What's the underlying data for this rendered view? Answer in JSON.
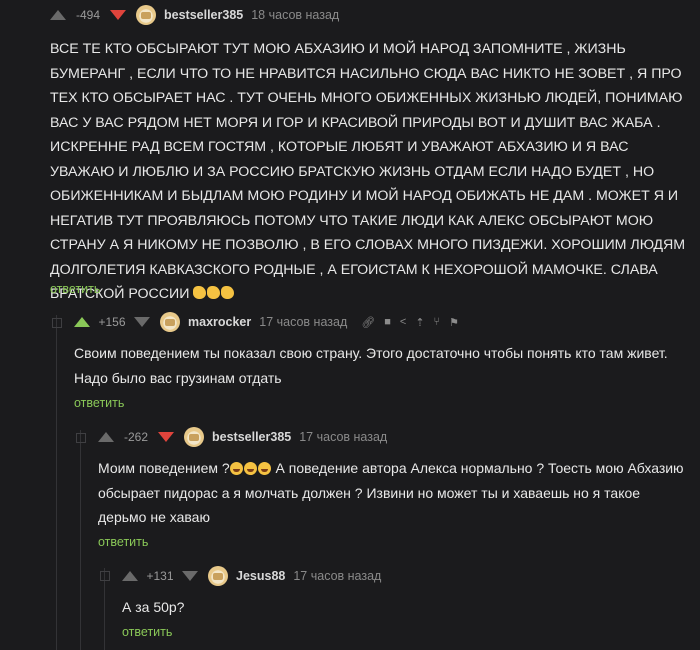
{
  "reply_label": "ответить",
  "comments": [
    {
      "score": "-494",
      "username": "bestseller385",
      "time": "18 часов назад",
      "text": "ВСЕ ТЕ КТО ОБСЫРАЮТ ТУТ МОЮ АБХАЗИЮ И МОЙ НАРОД ЗАПОМНИТЕ , ЖИЗНЬ БУМЕРАНГ , ЕСЛИ ЧТО ТО НЕ НРАВИТСЯ НАСИЛЬНО СЮДА ВАС НИКТО НЕ ЗОВЕТ , Я ПРО ТЕХ КТО ОБСЫРАЕТ НАС . ТУТ ОЧЕНЬ МНОГО ОБИЖЕННЫХ ЖИЗНЬЮ ЛЮДЕЙ, ПОНИМАЮ ВАС У ВАС РЯДОМ НЕТ МОРЯ И ГОР И КРАСИВОЙ ПРИРОДЫ ВОТ И ДУШИТ ВАС ЖАБА . ИСКРЕННЕ РАД ВСЕМ ГОСТЯМ , КОТОРЫЕ ЛЮБЯТ И УВАЖАЮТ АБХАЗИЮ И Я ВАС УВАЖАЮ И ЛЮБЛЮ И ЗА РОССИЮ БРАТСКУЮ ЖИЗНЬ ОТДАМ ЕСЛИ НАДО БУДЕТ , НО ОБИЖЕННИКАМ И БЫДЛАМ МОЮ РОДИНУ И МОЙ НАРОД ОБИЖАТЬ НЕ ДАМ . МОЖЕТ Я И НЕГАТИВ ТУТ ПРОЯВЛЯЮСЬ ПОТОМУ ЧТО ТАКИЕ ЛЮДИ КАК АЛЕКС ОБСЫРАЮТ МОЮ СТРАНУ А Я НИКОМУ НЕ ПОЗВОЛЮ , В ЕГО СЛОВАХ МНОГО ПИЗДЕЖИ. ХОРОШИМ ЛЮДЯМ ДОЛГОЛЕТИЯ КАВКАЗСКОГО РОДНЫЕ , А ЕГОИСТАМ  К НЕХОРОШОЙ МАМОЧКЕ. СЛАВА БРАТСКОЙ РОССИИ"
    },
    {
      "score": "+156",
      "username": "maxrocker",
      "time": "17 часов назад",
      "text": "Своим поведением ты показал свою страну. Этого достаточно чтобы понять кто там живет. Надо было вас грузинам отдать"
    },
    {
      "score": "-262",
      "username": "bestseller385",
      "time": "17 часов назад",
      "text_before": "Моим поведением ?",
      "text_after": " А поведение автора Алекса нормально ? Тоесть мою Абхазию обсырает пидорас а я молчать должен ? Извини но может ты и хаваешь но я такое дерьмо не хаваю"
    },
    {
      "score": "+131",
      "username": "Jesus88",
      "time": "17 часов назад",
      "text": "А за 50р?"
    }
  ]
}
